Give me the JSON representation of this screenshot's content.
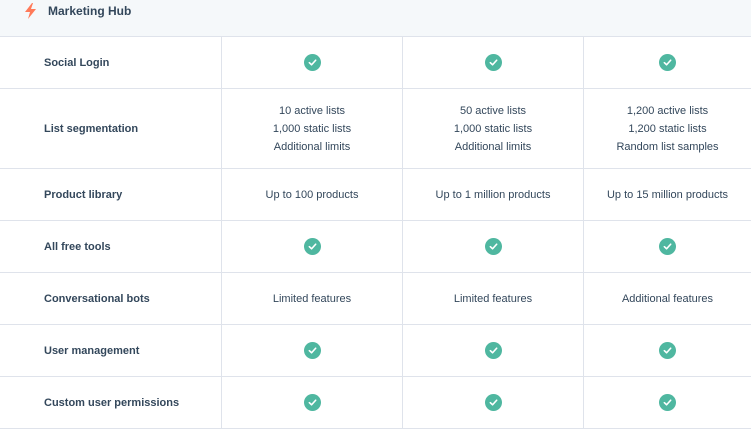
{
  "header": {
    "title": "Marketing Hub",
    "icon": "hubspot-sprocket-icon",
    "accent": "#ff7a59"
  },
  "colors": {
    "check": "#4fb7a0",
    "text": "#33475b",
    "border": "#dfe3eb",
    "header_bg": "#f5f8fa"
  },
  "rows": [
    {
      "label": "Social Login",
      "cells": [
        {
          "type": "check"
        },
        {
          "type": "check"
        },
        {
          "type": "check"
        }
      ]
    },
    {
      "label": "List segmentation",
      "cells": [
        {
          "type": "text",
          "lines": [
            "10 active lists",
            "1,000 static lists",
            "Additional limits"
          ]
        },
        {
          "type": "text",
          "lines": [
            "50 active lists",
            "1,000 static lists",
            "Additional limits"
          ]
        },
        {
          "type": "text",
          "lines": [
            "1,200 active lists",
            "1,200 static lists",
            "Random list samples"
          ]
        }
      ]
    },
    {
      "label": "Product library",
      "cells": [
        {
          "type": "text",
          "lines": [
            "Up to 100 products"
          ]
        },
        {
          "type": "text",
          "lines": [
            "Up to 1 million products"
          ]
        },
        {
          "type": "text",
          "lines": [
            "Up to 15 million products"
          ]
        }
      ]
    },
    {
      "label": "All free tools",
      "cells": [
        {
          "type": "check"
        },
        {
          "type": "check"
        },
        {
          "type": "check"
        }
      ]
    },
    {
      "label": "Conversational bots",
      "cells": [
        {
          "type": "text",
          "lines": [
            "Limited features"
          ]
        },
        {
          "type": "text",
          "lines": [
            "Limited features"
          ]
        },
        {
          "type": "text",
          "lines": [
            "Additional features"
          ]
        }
      ]
    },
    {
      "label": "User management",
      "cells": [
        {
          "type": "check"
        },
        {
          "type": "check"
        },
        {
          "type": "check"
        }
      ]
    },
    {
      "label": "Custom user permissions",
      "cells": [
        {
          "type": "check"
        },
        {
          "type": "check"
        },
        {
          "type": "check"
        }
      ]
    }
  ]
}
